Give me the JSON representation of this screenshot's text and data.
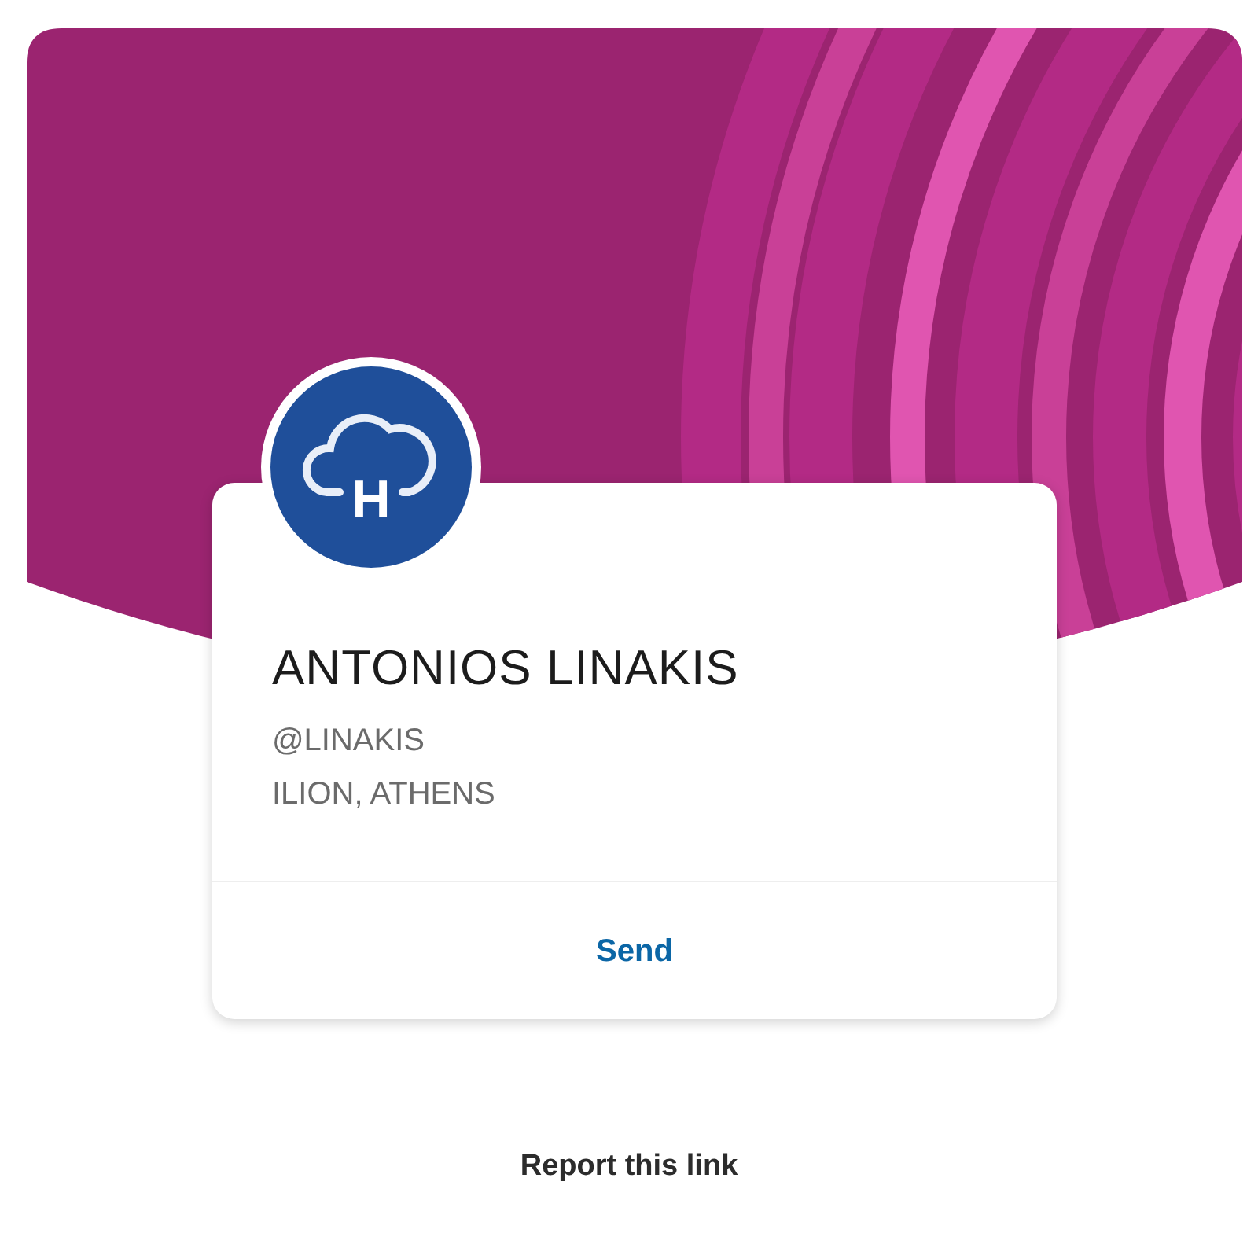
{
  "profile": {
    "avatar_letter": "H",
    "name": "ANTONIOS LINAKIS",
    "handle": "@LINAKIS",
    "location": "ILION, ATHENS"
  },
  "actions": [
    {
      "label": "Send"
    }
  ],
  "footer": {
    "report_link": "Report this link"
  }
}
